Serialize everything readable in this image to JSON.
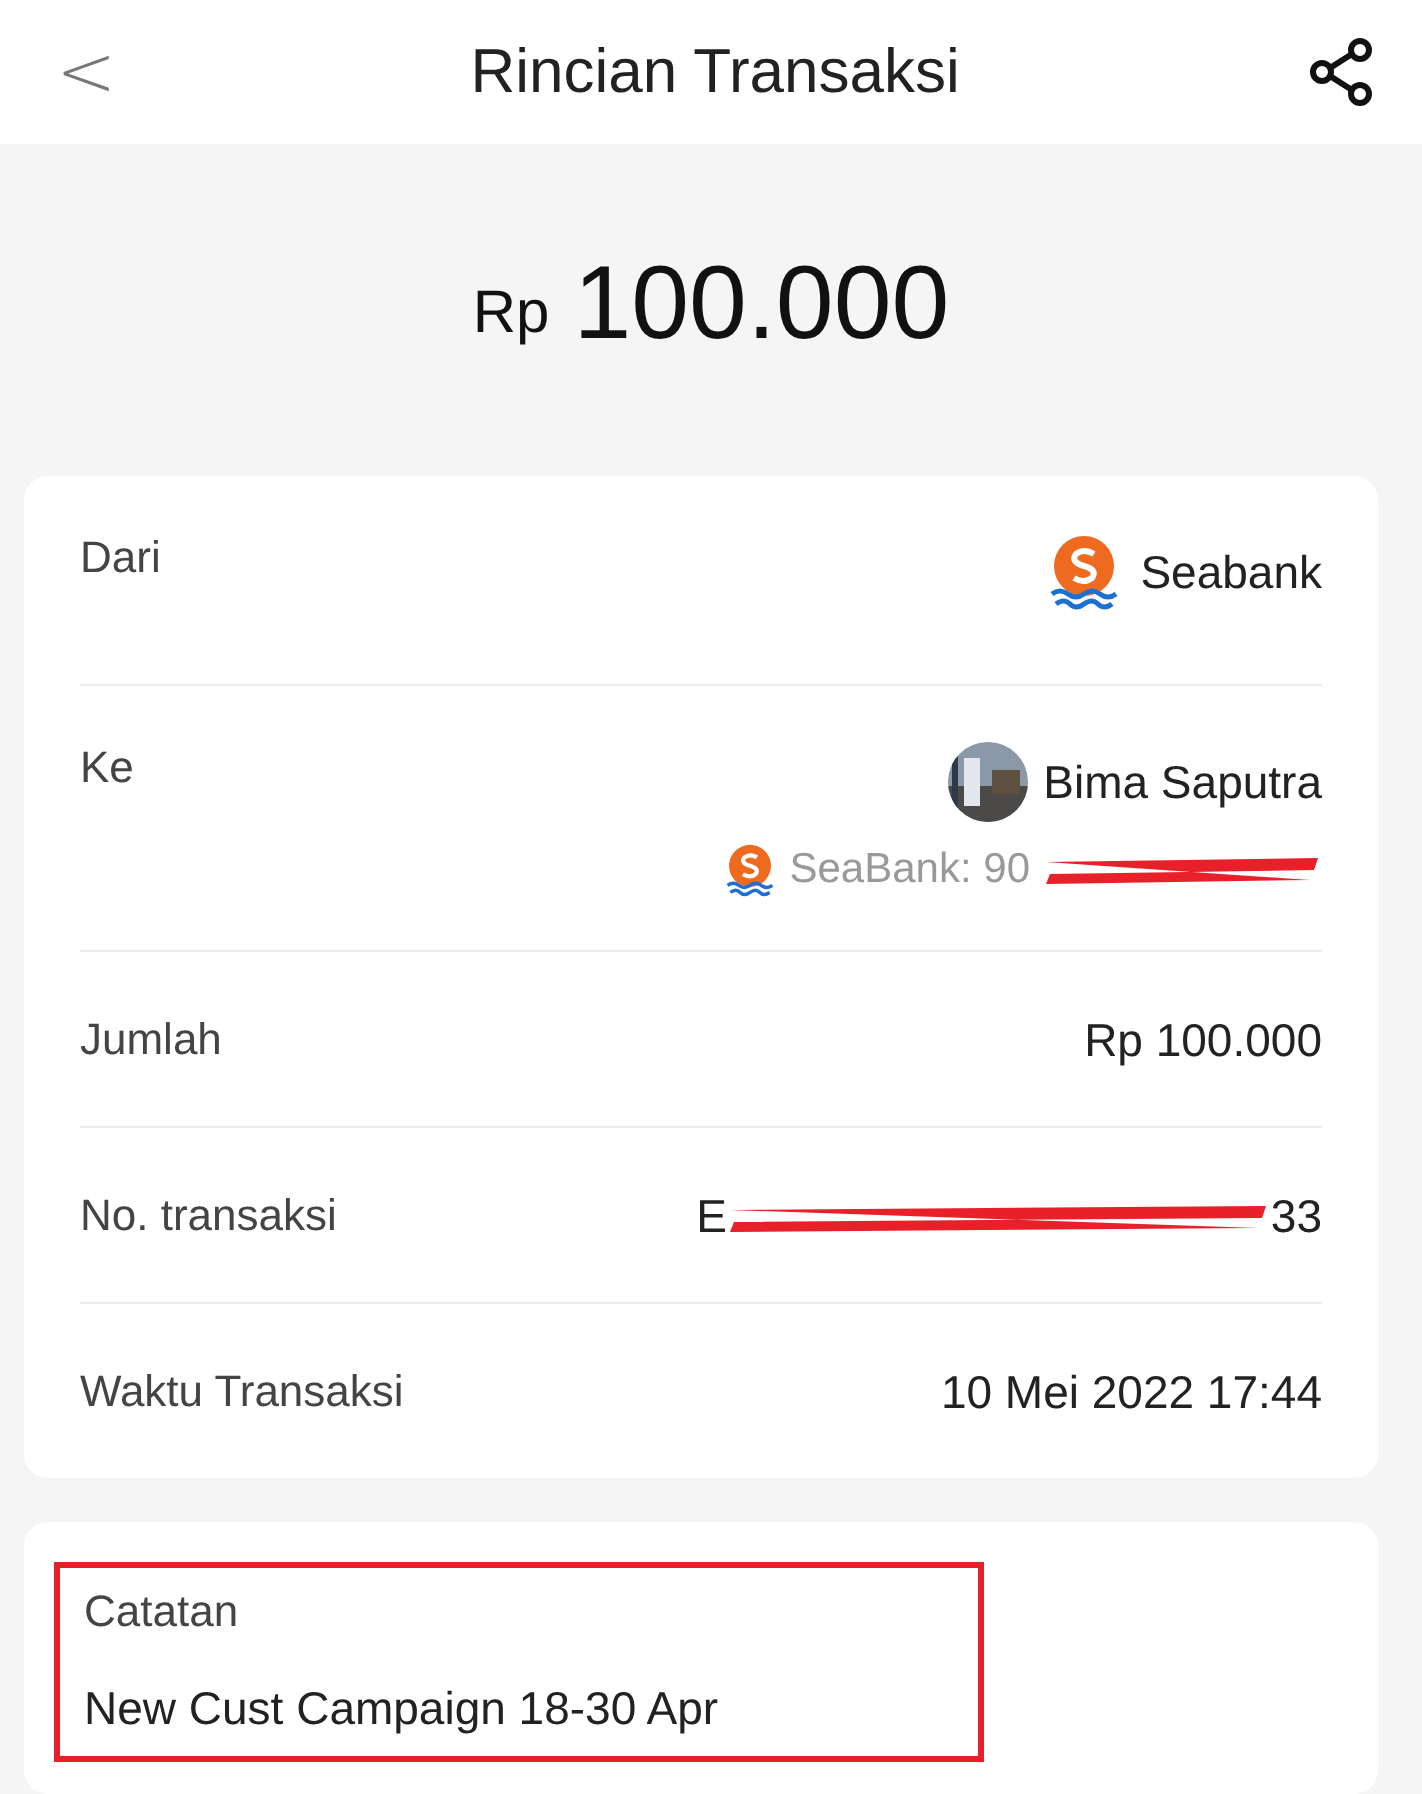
{
  "header": {
    "back": "<",
    "title": "Rincian Transaksi"
  },
  "amount": {
    "currency": "Rp",
    "value": "100.000"
  },
  "details": [
    {
      "kind": "bank",
      "label": "Dari",
      "value": "Seabank"
    },
    {
      "kind": "recipient",
      "label": "Ke",
      "value": "Bima Saputra",
      "account": "SeaBank: 90",
      "account_redacted": true
    },
    {
      "kind": "text",
      "label": "Jumlah",
      "value": "Rp 100.000"
    },
    {
      "kind": "redacted",
      "label": "No. transaksi",
      "value_start": "E",
      "value_end": "33"
    },
    {
      "kind": "text",
      "label": "Waktu Transaksi",
      "value": "10 Mei 2022 17:44"
    }
  ],
  "notes": {
    "label": "Catatan",
    "text": "New Cust Campaign 18-30 Apr",
    "highlighted": true
  }
}
